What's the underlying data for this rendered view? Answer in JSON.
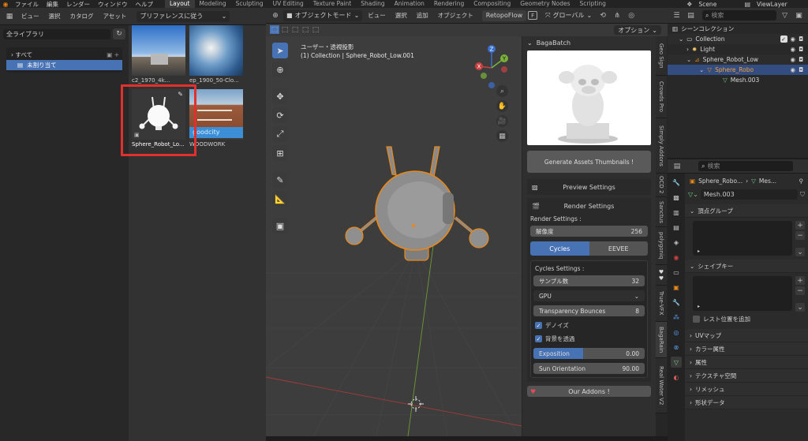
{
  "menubar": {
    "items": [
      "ファイル",
      "編集",
      "レンダー",
      "ウィンドウ",
      "ヘルプ"
    ],
    "workspaces": [
      "Layout",
      "Modeling",
      "Sculpting",
      "UV Editing",
      "Texture Paint",
      "Shading",
      "Animation",
      "Rendering",
      "Compositing",
      "Geometry Nodes",
      "Scripting"
    ],
    "scene": "Scene",
    "view_layer": "ViewLayer"
  },
  "asset_browser": {
    "menu": [
      "ビュー",
      "選択",
      "カタログ",
      "アセット"
    ],
    "import_mode": "プリファレンスに従う",
    "library": "全ライブラリ",
    "catalogs": [
      {
        "label": "すべて"
      },
      {
        "label": "未割り当て"
      }
    ],
    "assets": [
      {
        "name": "c2_1970_4k...",
        "kind": "sky"
      },
      {
        "name": "ep_1900_50-Clo...",
        "kind": "panorama"
      },
      {
        "name": "Sphere_Robot_Lo...",
        "kind": "robot"
      },
      {
        "name": "WOODWORK",
        "kind": "building"
      }
    ],
    "building_overlay": "goodcity"
  },
  "viewport": {
    "mode": "オブジェクトモード",
    "menu": [
      "ビュー",
      "選択",
      "追加",
      "オブジェクト"
    ],
    "retopoflow": "RetopoFlow",
    "transform": "グローバル",
    "options": "オプション",
    "view_name": "ユーザー・透視投影",
    "collection_info": "(1) Collection | Sphere_Robot_Low.001",
    "colors": {
      "selection": "#e8881a",
      "axis_x": "#c94040",
      "axis_y": "#7ab23a",
      "axis_z": "#3b70cf"
    }
  },
  "bagabatch": {
    "title": "BagaBatch",
    "generate_btn": "Generate Assets Thumbnails !",
    "preview_settings": "Preview Settings",
    "render_settings": "Render Settings",
    "render_settings_label": "Render Settings :",
    "resolution_label": "解像度",
    "resolution_value": "256",
    "engine_cycles": "Cycles",
    "engine_eevee": "EEVEE",
    "cycles_settings_label": "Cycles Settings :",
    "samples_label": "サンプル数",
    "samples_value": "32",
    "device": "GPU",
    "transparency_label": "Transparency Bounces",
    "transparency_value": "8",
    "denoise_label": "デノイズ",
    "transparent_bg_label": "背景を透過",
    "exposition_label": "Exposition",
    "exposition_value": "0.00",
    "exposition_fill": 0.45,
    "sun_orientation_label": "Sun Orientation",
    "sun_orientation_value": "90.00",
    "addons_btn": "Our Addons !"
  },
  "side_tabs": [
    "Geo Sign",
    "Crowds Pro",
    "Simply Addons",
    "OCD 2",
    "Sanctus",
    "polygoniq",
    "True-VFX",
    "BagaRain",
    "Real Water V2"
  ],
  "outliner": {
    "search_placeholder": "検索",
    "scene_collection": "シーンコレクション",
    "rows": [
      {
        "label": "Collection",
        "indent": 0
      },
      {
        "label": "Light",
        "indent": 1
      },
      {
        "label": "Sphere_Robot_Low",
        "indent": 1
      },
      {
        "label": "Sphere_Robo",
        "indent": 2
      },
      {
        "label": "Mesh.003",
        "indent": 3
      }
    ]
  },
  "properties": {
    "search_placeholder": "検索",
    "breadcrumb_obj": "Sphere_Robo...",
    "breadcrumb_mesh": "Mes...",
    "mesh_name": "Mesh.003",
    "vertex_groups": "頂点グループ",
    "shape_keys": "シェイプキー",
    "relative_label": "レスト位置を追加",
    "sections": [
      "UVマップ",
      "カラー属性",
      "属性",
      "テクスチャ空間",
      "リメッシュ",
      "形状データ"
    ]
  }
}
